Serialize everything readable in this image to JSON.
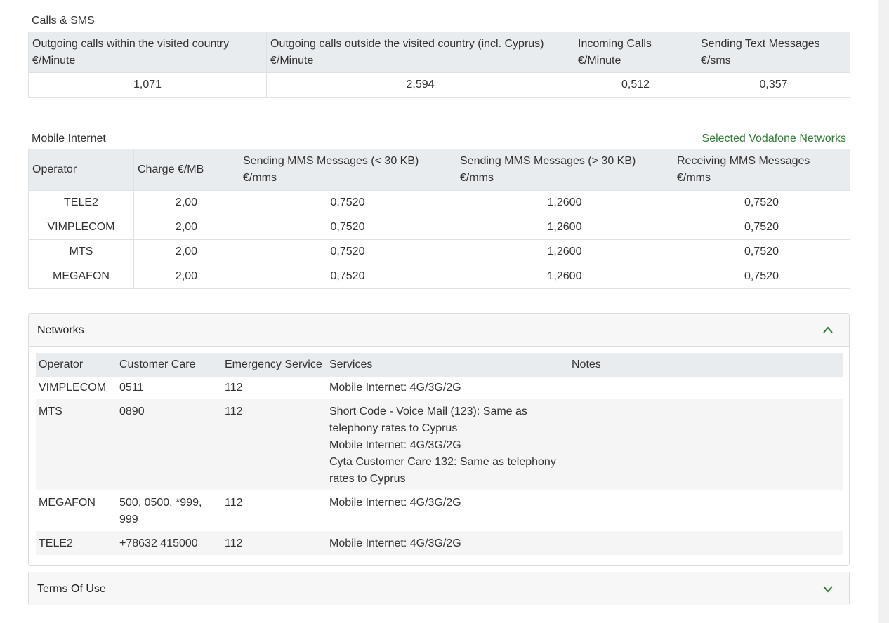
{
  "calls_sms": {
    "title": "Calls & SMS",
    "headers": [
      {
        "line1": "Outgoing calls within the visited country",
        "line2": "€/Minute"
      },
      {
        "line1": "Outgoing calls outside the visited country (incl. Cyprus)",
        "line2": "€/Minute"
      },
      {
        "line1": "Incoming Calls",
        "line2": "€/Minute"
      },
      {
        "line1": "Sending Text Messages",
        "line2": "€/sms"
      }
    ],
    "values": [
      "1,071",
      "2,594",
      "0,512",
      "0,357"
    ]
  },
  "mobile_internet": {
    "title": "Mobile Internet",
    "selected_networks_label": "Selected Vodafone Networks",
    "headers": [
      {
        "line1": "Operator",
        "line2": ""
      },
      {
        "line1": "Charge €/MB",
        "line2": ""
      },
      {
        "line1": "Sending MMS Messages (< 30 KB)",
        "line2": "€/mms"
      },
      {
        "line1": "Sending MMS Messages (> 30 KB)",
        "line2": "€/mms"
      },
      {
        "line1": "Receiving MMS Messages",
        "line2": "€/mms"
      }
    ],
    "rows": [
      [
        "TELE2",
        "2,00",
        "0,7520",
        "1,2600",
        "0,7520"
      ],
      [
        "VIMPLECOM",
        "2,00",
        "0,7520",
        "1,2600",
        "0,7520"
      ],
      [
        "MTS",
        "2,00",
        "0,7520",
        "1,2600",
        "0,7520"
      ],
      [
        "MEGAFON",
        "2,00",
        "0,7520",
        "1,2600",
        "0,7520"
      ]
    ]
  },
  "networks": {
    "title": "Networks",
    "expanded": true,
    "toggle_icon": "chevron-up-icon",
    "headers": [
      "Operator",
      "Customer Care",
      "Emergency Service",
      "Services",
      "Notes"
    ],
    "rows": [
      {
        "operator": "VIMPLECOM",
        "care": "0511",
        "emergency": "112",
        "services": [
          "Mobile Internet: 4G/3G/2G"
        ],
        "notes": ""
      },
      {
        "operator": "MTS",
        "care": "0890",
        "emergency": "112",
        "services": [
          "Short Code - Voice Mail (123): Same as telephony rates to Cyprus",
          "Mobile Internet: 4G/3G/2G",
          "Cyta Customer Care 132: Same as telephony rates to Cyprus"
        ],
        "notes": ""
      },
      {
        "operator": "MEGAFON",
        "care": "500, 0500, *999, 999",
        "emergency": "112",
        "services": [
          "Mobile Internet: 4G/3G/2G"
        ],
        "notes": ""
      },
      {
        "operator": "TELE2",
        "care": "+78632 415000",
        "emergency": "112",
        "services": [
          "Mobile Internet: 4G/3G/2G"
        ],
        "notes": ""
      }
    ]
  },
  "terms": {
    "title": "Terms Of Use",
    "expanded": false,
    "toggle_icon": "chevron-down-icon"
  },
  "colors": {
    "link_green": "#2e7d32",
    "chevron_green": "#2e7d32",
    "header_bg": "#e9ecef",
    "stripe_bg": "#f5f5f5"
  }
}
